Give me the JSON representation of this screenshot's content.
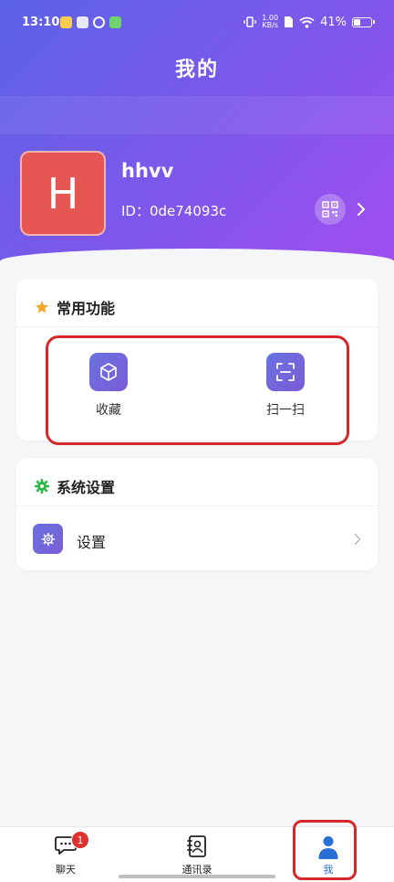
{
  "status_bar": {
    "time": "13:10",
    "net_speed_value": "1.00",
    "net_speed_unit": "KB/s",
    "battery": "41%",
    "battery_level": 0.41
  },
  "header": {
    "title": "我的"
  },
  "profile": {
    "avatar_letter": "H",
    "avatar_color": "#e65653",
    "username": "hhvv",
    "id_text": "ID：0de74093c"
  },
  "common_functions": {
    "title": "常用功能",
    "items": [
      {
        "label": "收藏",
        "icon": "cube-icon"
      },
      {
        "label": "扫一扫",
        "icon": "scan-icon"
      }
    ]
  },
  "system_settings": {
    "title": "系统设置",
    "items": [
      {
        "label": "设置",
        "icon": "gear-icon"
      }
    ]
  },
  "tabbar": {
    "tabs": [
      {
        "label": "聊天",
        "icon": "chat-icon",
        "badge": "1"
      },
      {
        "label": "通讯录",
        "icon": "contacts-icon"
      },
      {
        "label": "我",
        "icon": "person-icon",
        "active": true
      }
    ]
  },
  "colors": {
    "gradient_start": "#5b63e6",
    "gradient_end": "#a24ef0",
    "accent_red": "#d62828",
    "active_tab": "#2a6fd6",
    "star": "#f5a623",
    "settings_gear": "#2fb54a"
  }
}
